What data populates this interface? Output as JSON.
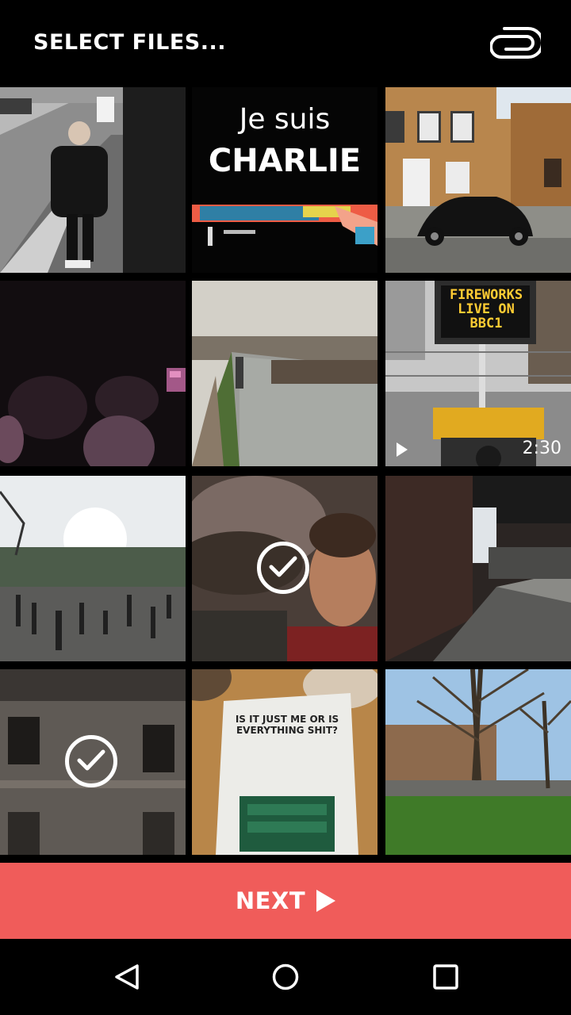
{
  "header": {
    "title": "SELECT FILES...",
    "attach_icon": "paperclip-icon"
  },
  "grid": {
    "tiles": [
      {
        "name": "photo-child-walking",
        "selected": false
      },
      {
        "name": "photo-je-suis-charlie",
        "selected": false,
        "text_line1": "Je suis",
        "text_line2": "CHARLIE"
      },
      {
        "name": "photo-vw-beetle-houses",
        "selected": false
      },
      {
        "name": "photo-dark-crowd",
        "selected": false
      },
      {
        "name": "photo-canal",
        "selected": false
      },
      {
        "name": "video-fireworks-sign",
        "selected": false,
        "type": "video",
        "duration": "2:30",
        "sign_text": "FIREWORKS LIVE ON BBC1"
      },
      {
        "name": "photo-park-crowd",
        "selected": false
      },
      {
        "name": "photo-selfie",
        "selected": true
      },
      {
        "name": "photo-street-bridge",
        "selected": false
      },
      {
        "name": "photo-building-facade",
        "selected": true
      },
      {
        "name": "photo-book",
        "selected": false,
        "book_title": "IS IT JUST ME OR IS EVERYTHING SHIT?"
      },
      {
        "name": "photo-trees-houses",
        "selected": false
      }
    ]
  },
  "next_button": {
    "label": "NEXT",
    "icon": "play-arrow-icon"
  },
  "navbar": {
    "back_icon": "back-triangle-icon",
    "home_icon": "home-circle-icon",
    "recents_icon": "recents-square-icon"
  },
  "colors": {
    "accent": "#f05c5a",
    "background": "#000000",
    "text": "#ffffff"
  }
}
